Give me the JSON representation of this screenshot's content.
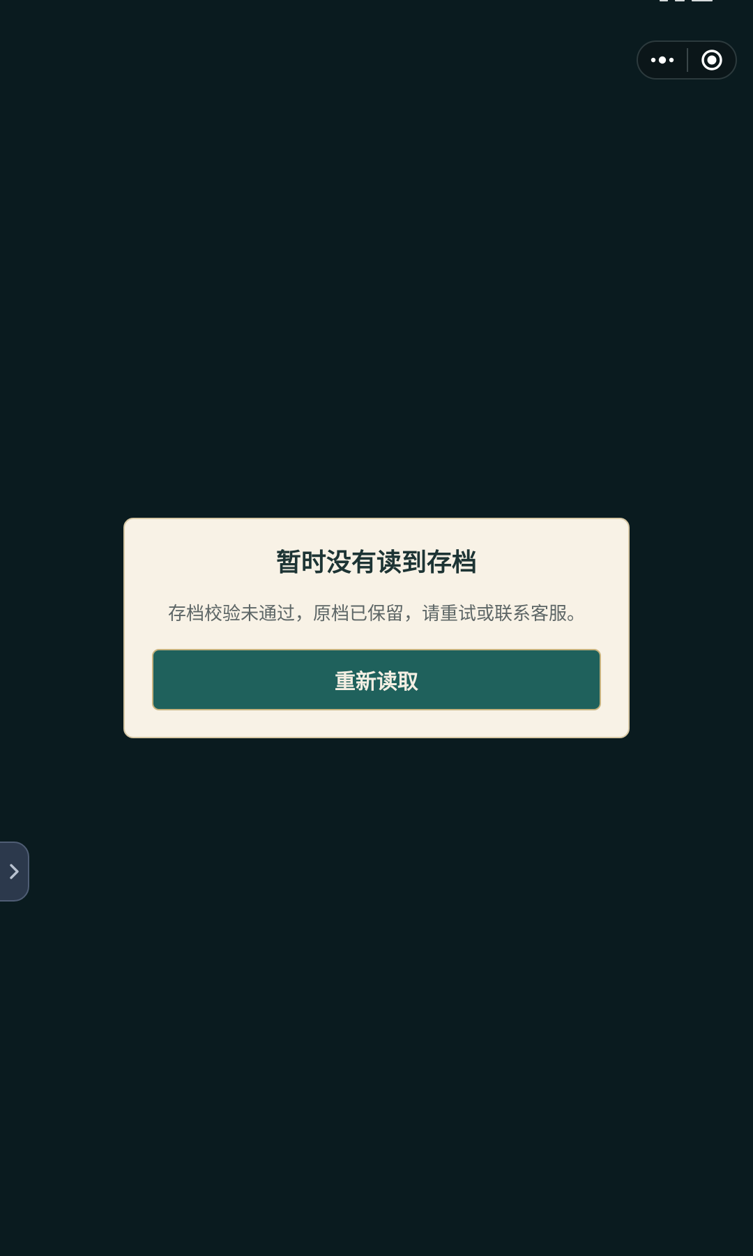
{
  "capsule": {
    "more_icon": "more-dots-icon",
    "close_icon": "target-circle-icon"
  },
  "dialog": {
    "title": "暂时没有读到存档",
    "message": "存档校验未通过，原档已保留，请重试或联系客服。",
    "retry_label": "重新读取"
  },
  "drawer": {
    "icon": "chevron-right-icon"
  },
  "colors": {
    "background": "#0a1b1f",
    "dialog_bg": "#f8f2e6",
    "dialog_border": "#d8c9a6",
    "button_bg": "#1f615c",
    "button_border": "#c7b37e",
    "title_text": "#1d3434",
    "message_text": "#5d6666",
    "drawer_bg": "#2c394c"
  }
}
